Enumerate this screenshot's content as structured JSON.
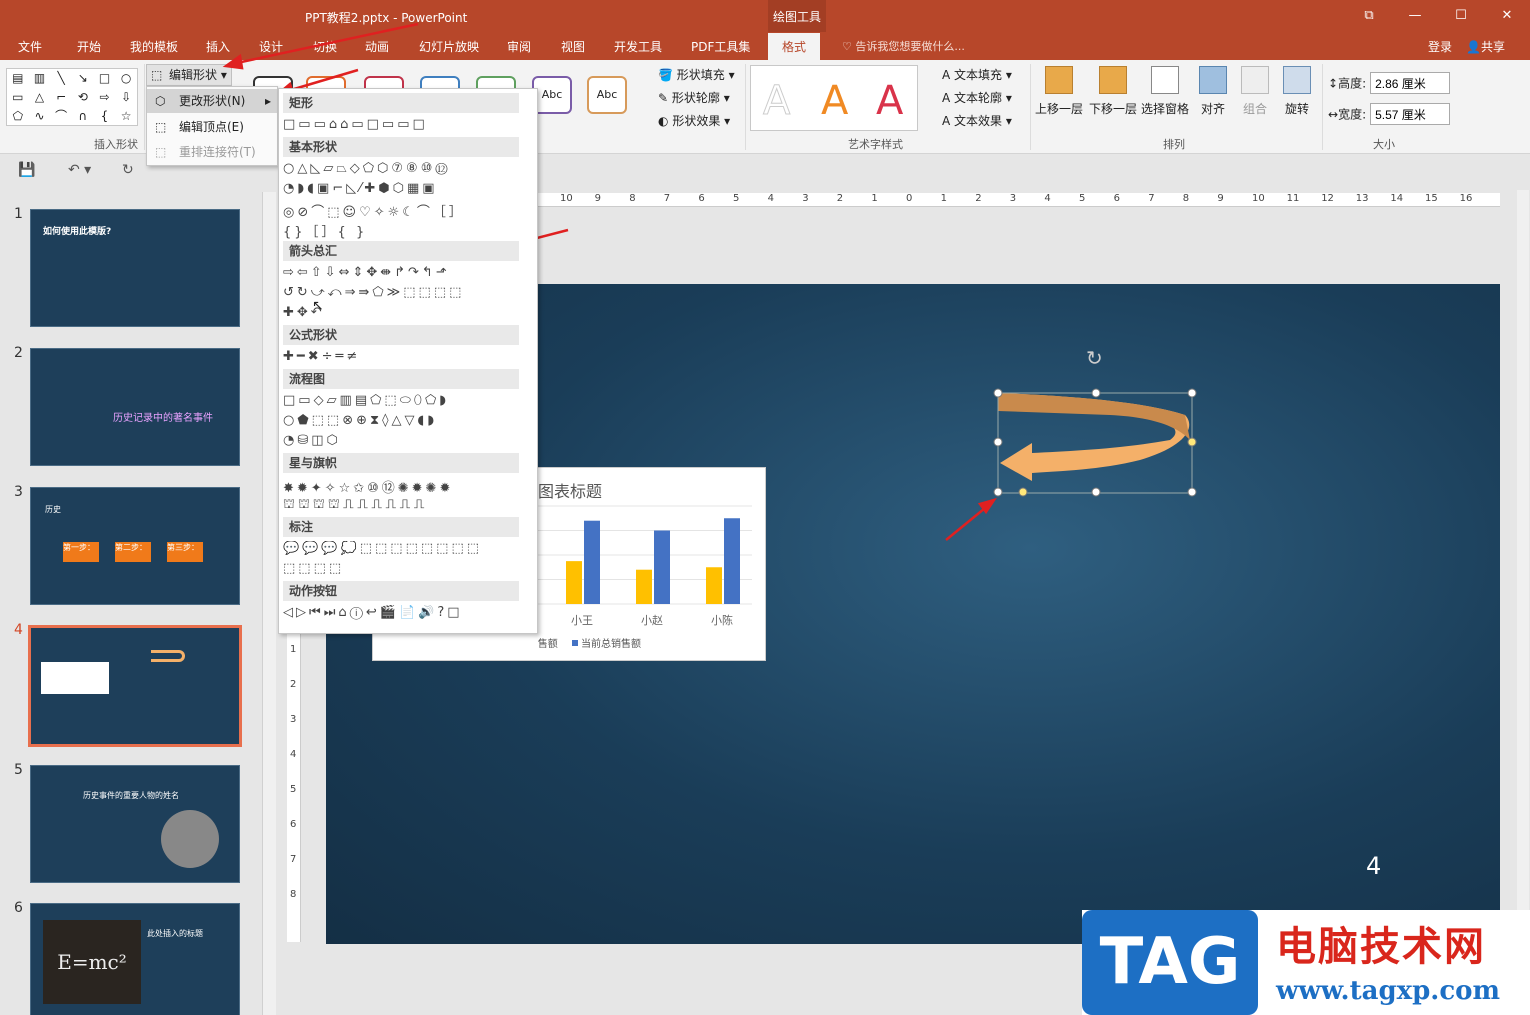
{
  "window": {
    "title": "PPT教程2.pptx - PowerPoint",
    "context_label": "绘图工具"
  },
  "tabs": [
    "文件",
    "开始",
    "我的模板",
    "插入",
    "设计",
    "切换",
    "动画",
    "幻灯片放映",
    "审阅",
    "视图",
    "开发工具",
    "PDF工具集",
    "格式"
  ],
  "tell_me": "告诉我您想要做什么...",
  "account": {
    "login": "登录",
    "share": "共享"
  },
  "ribbon": {
    "insert_shapes": {
      "label": "插入形状",
      "edit_shape": "编辑形状"
    },
    "style_sample": "Abc",
    "format_items": [
      "形状填充",
      "形状轮廓",
      "形状效果"
    ],
    "wordart": {
      "label": "艺术字样式",
      "letter": "A",
      "items": [
        "文本填充",
        "文本轮廓",
        "文本效果"
      ]
    },
    "arrange": {
      "label": "排列",
      "items": [
        "上移一层",
        "下移一层",
        "选择窗格",
        "对齐",
        "组合",
        "旋转"
      ]
    },
    "size": {
      "label": "大小",
      "height_label": "高度:",
      "height_value": "2.86 厘米",
      "width_label": "宽度:",
      "width_value": "5.57 厘米"
    }
  },
  "edit_menu": {
    "change_shape": "更改形状(N)",
    "edit_points": "编辑顶点(E)",
    "reroute": "重排连接符(T)"
  },
  "gallery": {
    "categories": [
      "矩形",
      "基本形状",
      "箭头总汇",
      "公式形状",
      "流程图",
      "星与旗帜",
      "标注",
      "动作按钮"
    ]
  },
  "ruler": {
    "h_ticks": [
      "10",
      "9",
      "8",
      "7",
      "6",
      "5",
      "4",
      "3",
      "2",
      "1",
      "0",
      "1",
      "2",
      "3",
      "4",
      "5",
      "6",
      "7",
      "8",
      "9",
      "10",
      "11",
      "12",
      "13",
      "14",
      "15",
      "16"
    ],
    "v_ticks": [
      "1",
      "2",
      "3",
      "4",
      "5",
      "6",
      "7",
      "8"
    ]
  },
  "slide": {
    "page_number": "4"
  },
  "chart_data": {
    "type": "bar",
    "title": "图表标题",
    "categories": [
      "小王",
      "小赵",
      "小陈"
    ],
    "series": [
      {
        "name": "11月销售额",
        "values": [
          35,
          28,
          30
        ],
        "color": "#ffc000"
      },
      {
        "name": "当前总销售额",
        "values": [
          68,
          60,
          70
        ],
        "color": "#4472c4"
      }
    ],
    "ylim": [
      0,
      80
    ],
    "legend": "bottom"
  },
  "thumbnails": [
    {
      "num": "1",
      "title": "如何使用此模版?"
    },
    {
      "num": "2",
      "title": "历史记录中的著名事件"
    },
    {
      "num": "3",
      "title": "历史",
      "steps": [
        "第一步：",
        "第二步：",
        "第三步："
      ]
    },
    {
      "num": "4"
    },
    {
      "num": "5",
      "title": "历史事件的重要人物的姓名"
    },
    {
      "num": "6",
      "title": "此处插入的标题",
      "formula": "E=mc²"
    }
  ],
  "watermark": {
    "badge": "TAG",
    "title": "电脑技术网",
    "url": "www.tagxp.com"
  },
  "colors": {
    "accent": "#b7472a",
    "arrow_fill": "#f4b069",
    "arrow_dark": "#c98a4c"
  }
}
